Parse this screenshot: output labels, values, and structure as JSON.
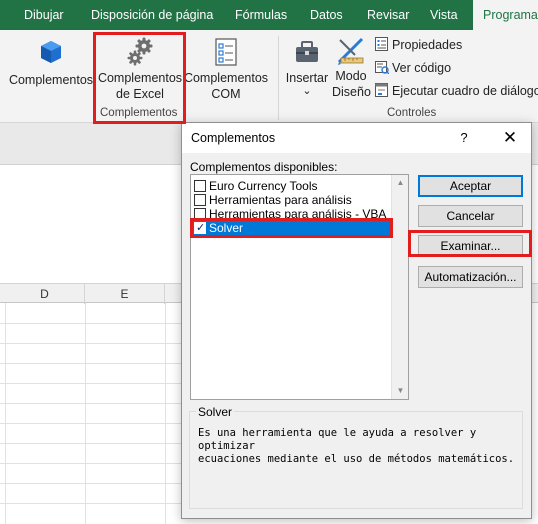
{
  "ribbon_tabs": {
    "dibujar": "Dibujar",
    "disposicion": "Disposición de página",
    "formulas": "Fórmulas",
    "datos": "Datos",
    "revisar": "Revisar",
    "vista": "Vista",
    "programador": "Programad"
  },
  "ribbon": {
    "complementos": "Complementos",
    "excel_addins_line1": "Complementos",
    "excel_addins_line2": "de Excel",
    "com_addins_line1": "Complementos",
    "com_addins_line2": "COM",
    "group_complementos": "Complementos",
    "insertar": "Insertar",
    "modo_line1": "Modo",
    "modo_line2": "Diseño",
    "propiedades": "Propiedades",
    "ver_codigo": "Ver código",
    "ejecutar": "Ejecutar cuadro de diálogo",
    "group_controles": "Controles",
    "insert_dropdown": "⌄"
  },
  "sheet": {
    "columns": [
      "D",
      "E"
    ]
  },
  "dialog": {
    "title": "Complementos",
    "help": "?",
    "close": "✕",
    "available_label": "Complementos disponibles:",
    "items": [
      {
        "label": "Euro Currency Tools",
        "checked": false
      },
      {
        "label": "Herramientas para análisis",
        "checked": false
      },
      {
        "label": "Herramientas para análisis - VBA",
        "checked": false
      },
      {
        "label": "Solver",
        "checked": true
      }
    ],
    "check_mark": "✓",
    "scroll_up": "▲",
    "scroll_down": "▼",
    "buttons": {
      "accept": "Aceptar",
      "cancel": "Cancelar",
      "browse": "Examinar...",
      "automation": "Automatización..."
    },
    "description_title": "Solver",
    "description_line1": "Es una herramienta que le ayuda a resolver y optimizar",
    "description_line2": "ecuaciones mediante el uso de métodos matemáticos."
  },
  "colors": {
    "ribbon_green": "#217346",
    "highlight_red": "#e11d1d",
    "selection_blue": "#0078d7"
  }
}
